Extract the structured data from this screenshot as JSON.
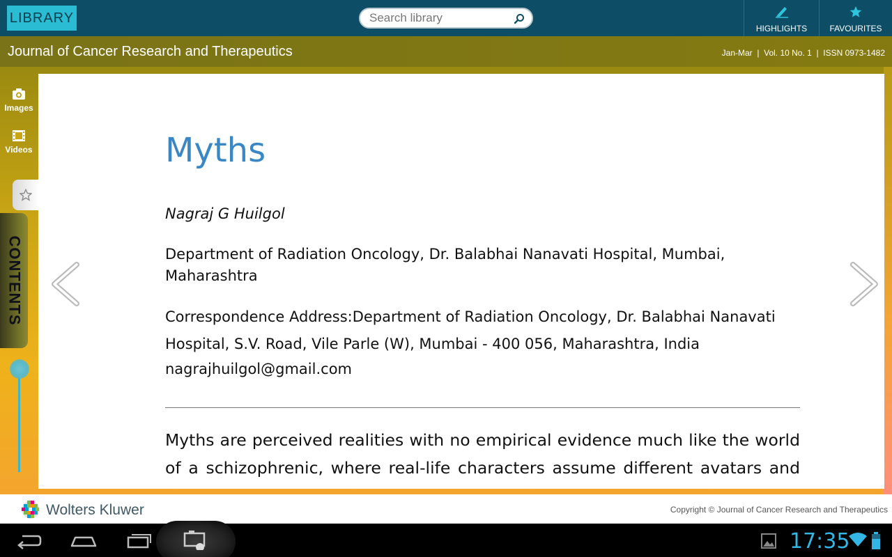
{
  "topbar": {
    "library_label": "LIBRARY",
    "search_placeholder": "Search library",
    "highlights_label": "HIGHLIGHTS",
    "favourites_label": "FAVOURITES"
  },
  "journal": {
    "title": "Journal of Cancer Research and Therapeutics",
    "issue_info": "Jan-Mar  |  Vol. 10 No. 1  |  ISSN 0973-1482"
  },
  "sidebar": {
    "images_label": "Images",
    "videos_label": "Videos",
    "contents_label": "CONTENTS"
  },
  "article": {
    "title": "Myths",
    "author": "Nagraj G Huilgol",
    "department": "Department of Radiation Oncology, Dr. Balabhai Nanavati Hospital, Mumbai, Maharashtra",
    "correspondence": "Correspondence Address:Department of Radiation Oncology, Dr. Balabhai Nanavati Hospital, S.V. Road, Vile Parle (W), Mumbai - 400 056, Maharashtra, India",
    "email": "nagrajhuilgol@gmail.com",
    "body": "Myths are perceived realities with no empirical evidence much like the world of a schizophrenic, where real-life characters assume different avatars and play"
  },
  "footer": {
    "publisher": "Wolters Kluwer",
    "copyright": "Copyright © Journal of Cancer Research and Therapeutics"
  },
  "system": {
    "clock": "17:35"
  },
  "colors": {
    "topbar": "#0d4e66",
    "library_button": "#29bcd2",
    "title_blue": "#3a87c5",
    "clock_blue": "#33b5e5"
  }
}
